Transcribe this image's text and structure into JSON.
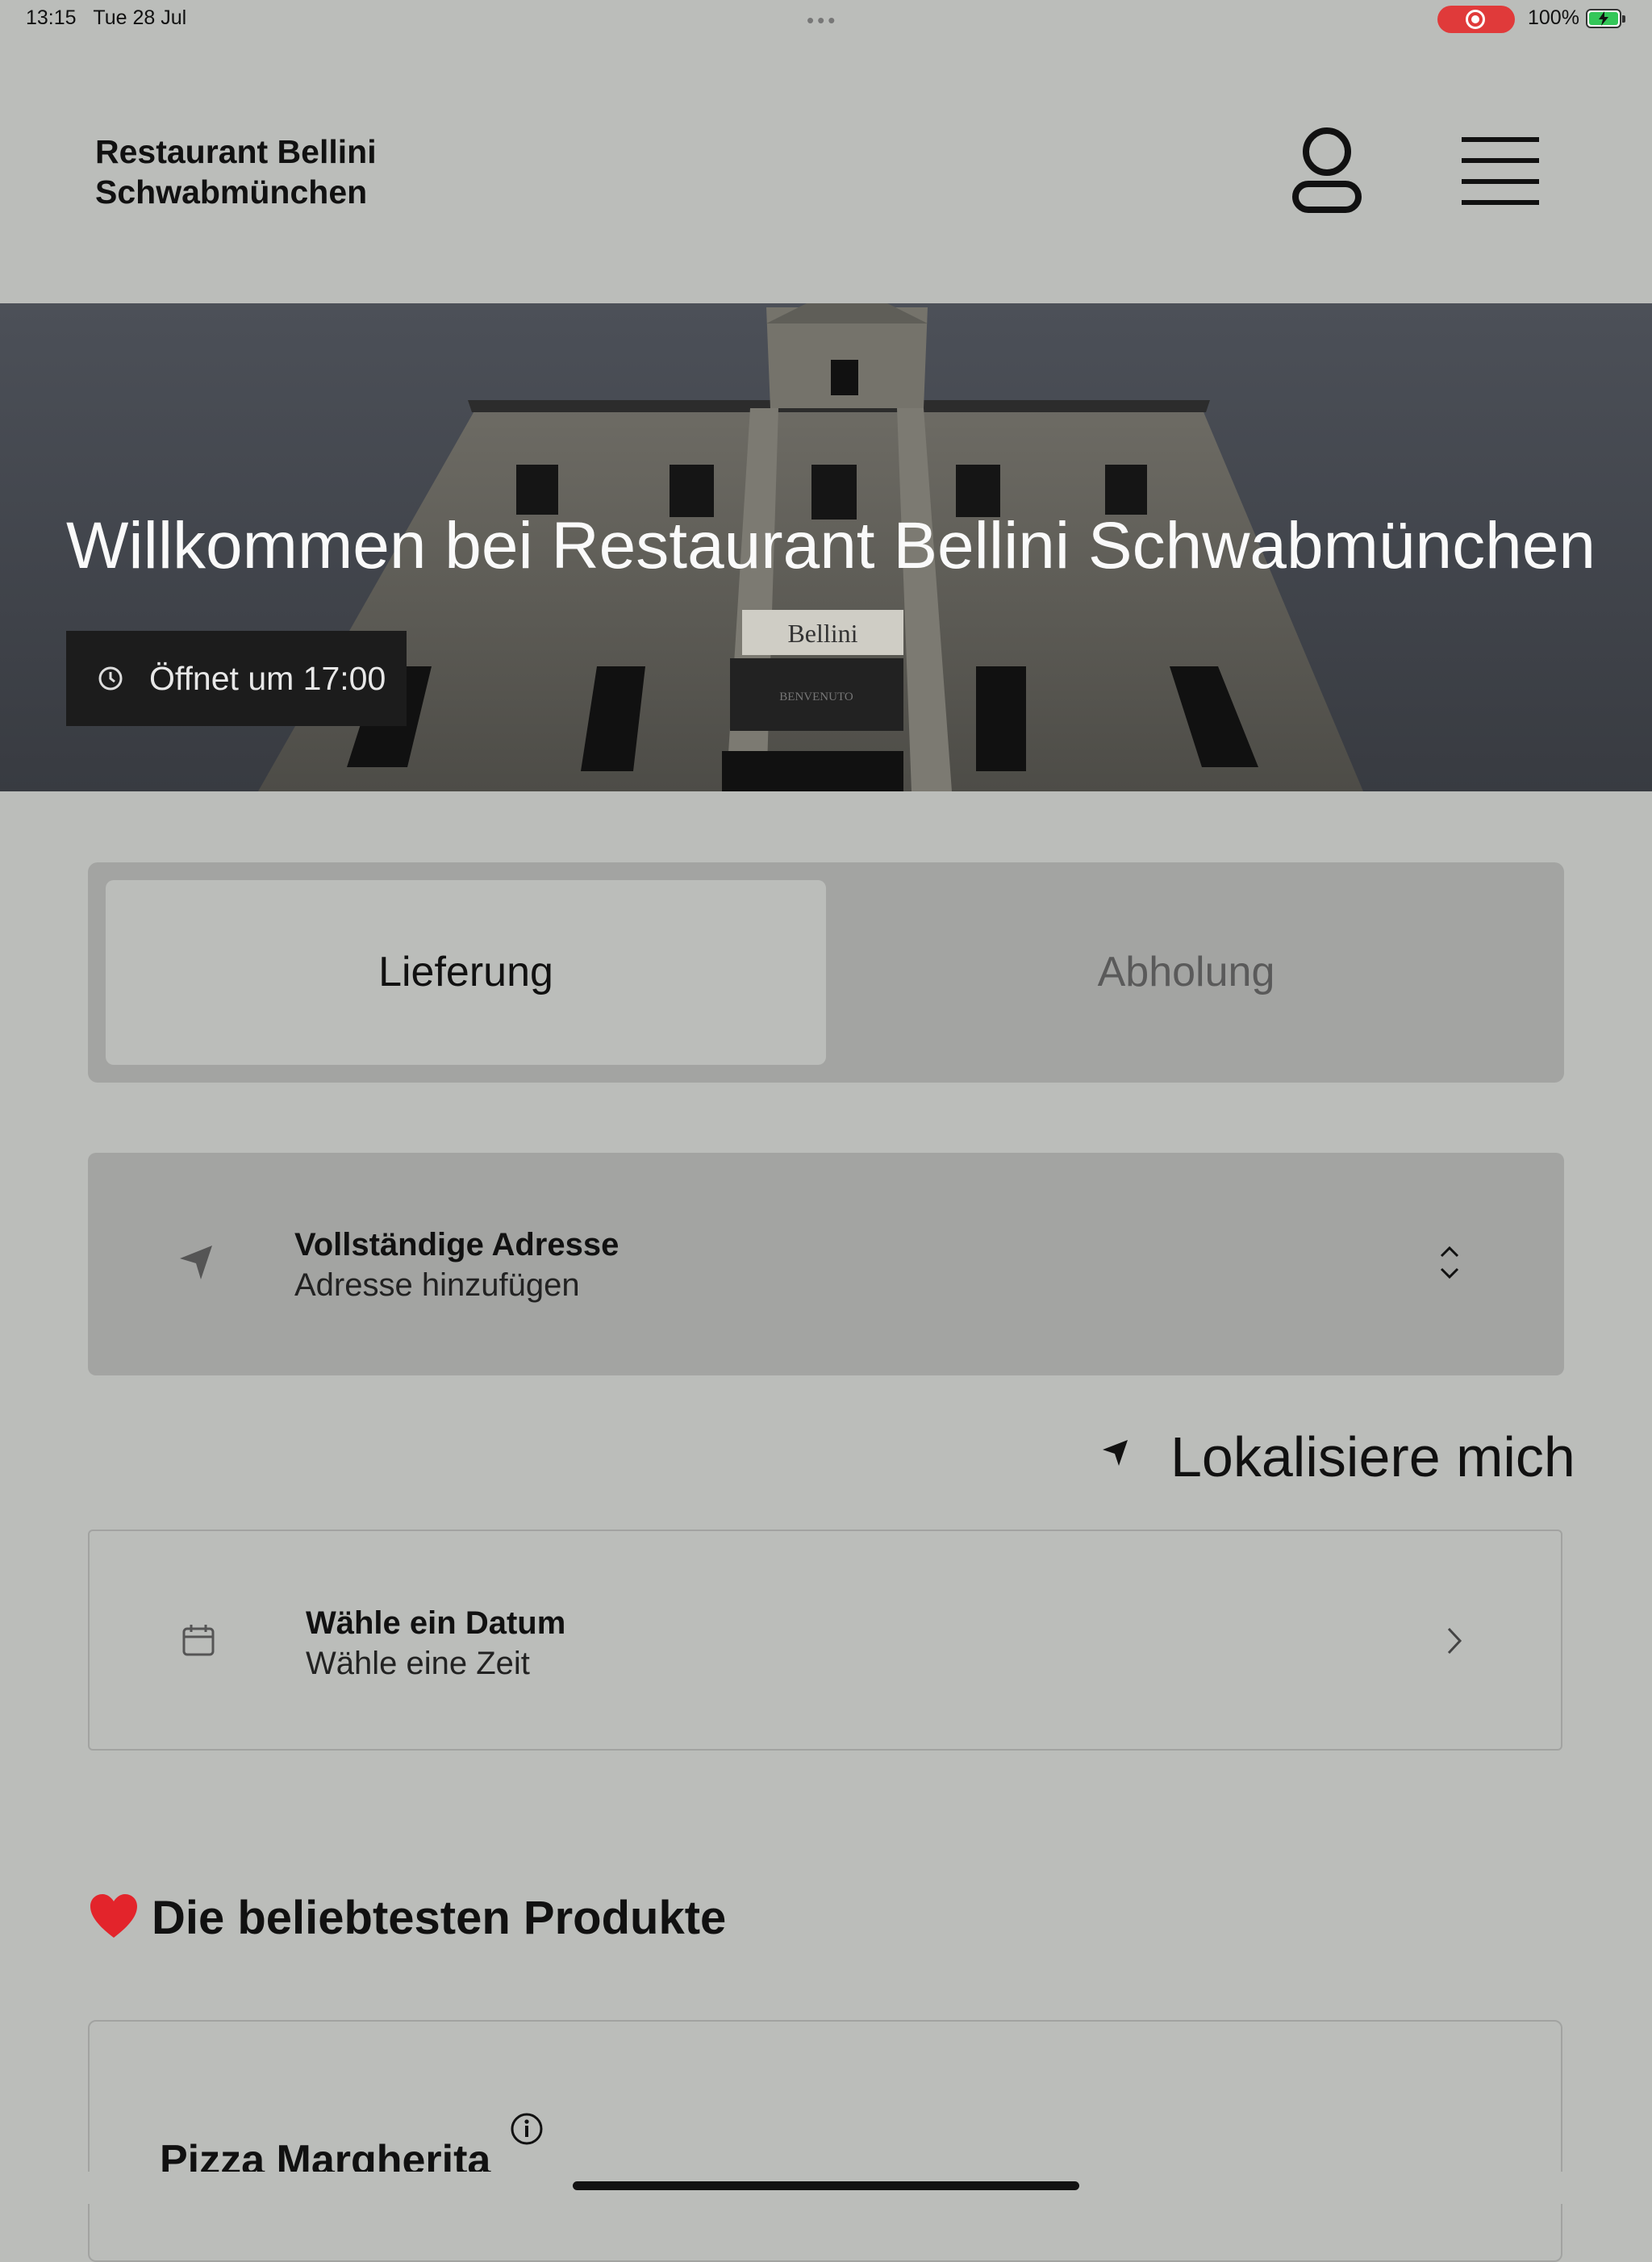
{
  "status": {
    "time": "13:15",
    "date": "Tue 28 Jul",
    "battery": "100%"
  },
  "header": {
    "brand_line1": "Restaurant Bellini",
    "brand_line2": "Schwabmünchen"
  },
  "hero": {
    "title": "Willkommen bei Restaurant Bellini Schwabmünchen",
    "opening": "Öffnet um 17:00",
    "sign_text": "Bellini",
    "sign_subtext": "BENVENUTO"
  },
  "order_mode": {
    "tabs": [
      "Lieferung",
      "Abholung"
    ],
    "selected": "Lieferung"
  },
  "address": {
    "title": "Vollständige Adresse",
    "subtitle": "Adresse hinzufügen"
  },
  "locate": {
    "label": "Lokalisiere mich"
  },
  "schedule": {
    "title": "Wähle ein Datum",
    "subtitle": "Wähle eine Zeit"
  },
  "popular": {
    "title": "Die beliebtesten Produkte",
    "icon": "heart-icon",
    "products": [
      {
        "name": "Pizza Margherita"
      }
    ]
  },
  "colors": {
    "background": "#bbbdba",
    "panel": "#a3a4a2",
    "badge": "#1c1c1c",
    "heart": "#e3242b",
    "record": "#e03a3a",
    "battery": "#34c759"
  }
}
